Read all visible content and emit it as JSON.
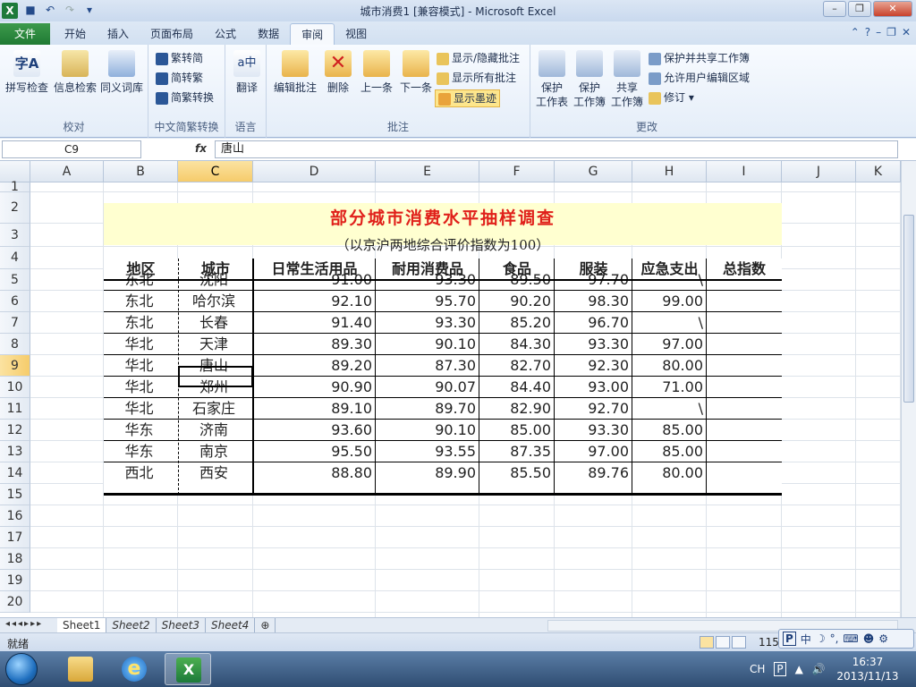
{
  "window": {
    "title": "城市消费1  [兼容模式] - Microsoft Excel",
    "app_icon": "X"
  },
  "tabs": {
    "file": "文件",
    "items": [
      "开始",
      "插入",
      "页面布局",
      "公式",
      "数据",
      "审阅",
      "视图"
    ],
    "active": "审阅"
  },
  "ribbon": {
    "proofing": {
      "label": "校对",
      "spell": "拼写检查",
      "research": "信息检索",
      "thesaurus": "同义词库"
    },
    "chinese": {
      "label": "中文简繁转换",
      "to_simplified": "繁转简",
      "to_traditional": "简转繁",
      "convert": "简繁转换"
    },
    "language": {
      "label": "语言",
      "translate": "翻译"
    },
    "comments": {
      "label": "批注",
      "edit": "编辑批注",
      "delete": "删除",
      "prev": "上一条",
      "next": "下一条",
      "show_hide": "显示/隐藏批注",
      "show_all": "显示所有批注",
      "show_ink": "显示墨迹"
    },
    "changes": {
      "label": "更改",
      "protect_sheet_1": "保护",
      "protect_sheet_2": "工作表",
      "protect_book_1": "保护",
      "protect_book_2": "工作簿",
      "share_1": "共享",
      "share_2": "工作簿",
      "protect_share": "保护并共享工作簿",
      "allow_edit": "允许用户编辑区域",
      "track": "修订"
    }
  },
  "formula_bar": {
    "name_box": "C9",
    "fx": "fx",
    "value": "唐山"
  },
  "columns": [
    "A",
    "B",
    "C",
    "D",
    "E",
    "F",
    "G",
    "H",
    "I",
    "J",
    "K"
  ],
  "rows": [
    "1",
    "2",
    "3",
    "4",
    "5",
    "6",
    "7",
    "8",
    "9",
    "10",
    "11",
    "12",
    "13",
    "14",
    "15",
    "16",
    "17",
    "18",
    "19",
    "20"
  ],
  "sheet": {
    "title": "部分城市消费水平抽样调查",
    "subtitle": "（以京沪两地综合评价指数为100）",
    "headers": [
      "地区",
      "城市",
      "日常生活用品",
      "耐用消费品",
      "食品",
      "服装",
      "应急支出",
      "总指数"
    ],
    "data": [
      [
        "东北",
        "沈阳",
        "91.00",
        "93.30",
        "89.50",
        "97.70",
        "\\",
        ""
      ],
      [
        "东北",
        "哈尔滨",
        "92.10",
        "95.70",
        "90.20",
        "98.30",
        "99.00",
        ""
      ],
      [
        "东北",
        "长春",
        "91.40",
        "93.30",
        "85.20",
        "96.70",
        "\\",
        ""
      ],
      [
        "华北",
        "天津",
        "89.30",
        "90.10",
        "84.30",
        "93.30",
        "97.00",
        ""
      ],
      [
        "华北",
        "唐山",
        "89.20",
        "87.30",
        "82.70",
        "92.30",
        "80.00",
        ""
      ],
      [
        "华北",
        "郑州",
        "90.90",
        "90.07",
        "84.40",
        "93.00",
        "71.00",
        ""
      ],
      [
        "华北",
        "石家庄",
        "89.10",
        "89.70",
        "82.90",
        "92.70",
        "\\",
        ""
      ],
      [
        "华东",
        "济南",
        "93.60",
        "90.10",
        "85.00",
        "93.30",
        "85.00",
        ""
      ],
      [
        "华东",
        "南京",
        "95.50",
        "93.55",
        "87.35",
        "97.00",
        "85.00",
        ""
      ],
      [
        "西北",
        "西安",
        "88.80",
        "89.90",
        "85.50",
        "89.76",
        "80.00",
        ""
      ]
    ]
  },
  "sheet_tabs": [
    "Sheet1",
    "Sheet2",
    "Sheet3",
    "Sheet4"
  ],
  "status": {
    "ready": "就绪",
    "zoom": "115"
  },
  "ime": {
    "lang": "中"
  },
  "taskbar": {
    "lang": "CH",
    "time": "16:37",
    "date": "2013/11/13"
  },
  "colors": {
    "title_red": "#e0201a",
    "title_band": "#ffffd0",
    "selection": "#f6cc6b"
  }
}
